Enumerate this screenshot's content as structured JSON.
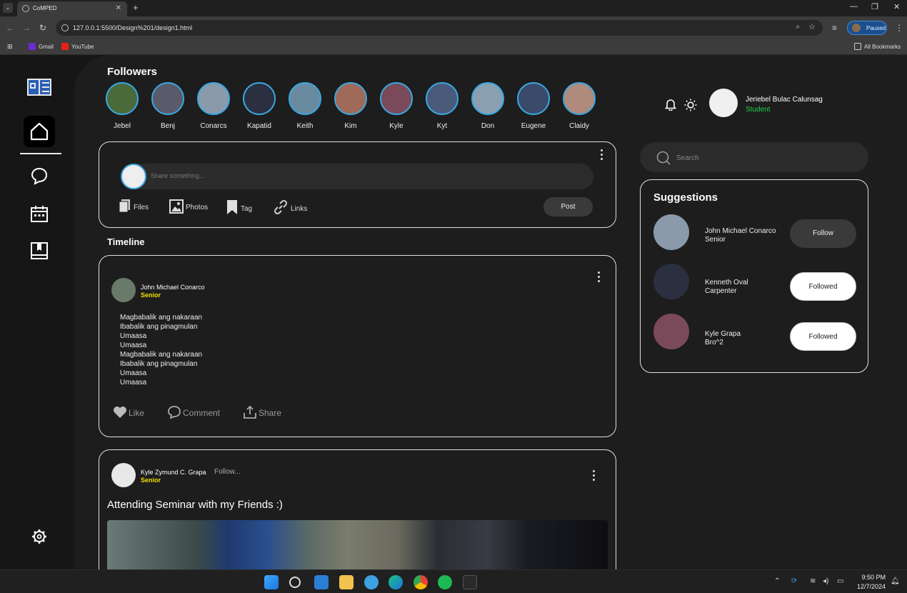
{
  "browser": {
    "tab_title": "CoMPED",
    "url": "127.0.0.1:5500/Design%201/design1.html",
    "profile_status": "Paused",
    "bookmarks": [
      "Gmail",
      "YouTube"
    ],
    "all_bookmarks": "All Bookmarks"
  },
  "followers": {
    "title": "Followers",
    "items": [
      {
        "name": "Jebel",
        "color": "#4a6a3a"
      },
      {
        "name": "Benj",
        "color": "#5a5a6a"
      },
      {
        "name": "Conarcs",
        "color": "#8a9aaa"
      },
      {
        "name": "Kapatid",
        "color": "#2a3040"
      },
      {
        "name": "Keith",
        "color": "#6a8aa0"
      },
      {
        "name": "Kim",
        "color": "#a06a5a"
      },
      {
        "name": "Kyle",
        "color": "#7a4a5a"
      },
      {
        "name": "Kyt",
        "color": "#4a5a7a"
      },
      {
        "name": "Don",
        "color": "#8aa0b0"
      },
      {
        "name": "Eugene",
        "color": "#3a4a6a"
      },
      {
        "name": "Claidy",
        "color": "#b08a7a"
      }
    ]
  },
  "composer": {
    "placeholder": "Share something...",
    "tools": [
      "Files",
      "Photos",
      "Tag",
      "Links"
    ],
    "post_label": "Post"
  },
  "timeline": {
    "title": "Timeline",
    "posts": [
      {
        "author": "John Michael Conarco",
        "role": "Senior",
        "lines": [
          "Magbabalik ang nakaraan",
          "Ibabalik ang pinagmulan",
          "Umaasa",
          "Umaasa",
          "Magbabalik ang nakaraan",
          "Ibabalik ang pinagmulan",
          "Umaasa",
          "Umaasa"
        ],
        "actions": [
          "Like",
          "Comment",
          "Share"
        ]
      },
      {
        "author": "Kyle Zymund C. Grapa",
        "role": "Senior",
        "follow_label": "Follow...",
        "title": "Attending Seminar with my Friends :)"
      }
    ]
  },
  "user": {
    "name": "Jeriebel Bulac Calunsag",
    "role": "Student"
  },
  "search": {
    "placeholder": "Search"
  },
  "suggestions": {
    "title": "Suggestions",
    "items": [
      {
        "name": "John Michael Conarco",
        "sub": "Senior",
        "button": "Follow",
        "state": "follow"
      },
      {
        "name": "Kenneth Oval",
        "sub": "Carpenter",
        "button": "Followed",
        "state": "followed"
      },
      {
        "name": "Kyle Grapa",
        "sub": "Bro^2",
        "button": "Followed",
        "state": "followed"
      }
    ]
  },
  "taskbar": {
    "time": "9:50 PM",
    "date": "12/7/2024"
  },
  "colors": {
    "accent_ring": "#3aa7e0",
    "role_yellow": "#f1e000",
    "student_green": "#25d047"
  }
}
